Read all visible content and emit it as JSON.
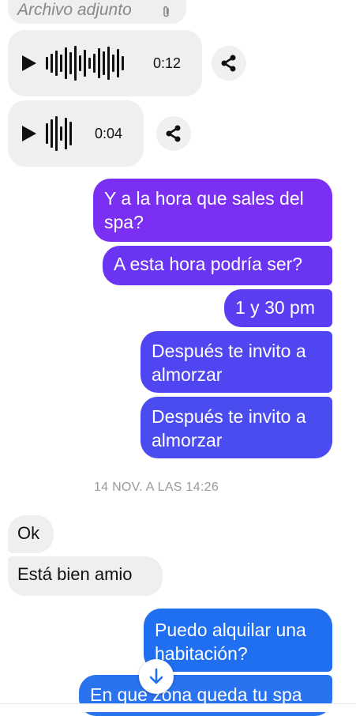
{
  "attachment": {
    "label": "Archivo adjunto",
    "icon": "paperclip-icon"
  },
  "audio_messages": [
    {
      "duration": "0:12"
    },
    {
      "duration": "0:04"
    }
  ],
  "outgoing_messages_1": [
    {
      "text": "Y a la hora que sales del spa?"
    },
    {
      "text": "A esta hora podría ser?"
    },
    {
      "text": "1 y 30 pm"
    },
    {
      "text": "Después te invito a almorzar"
    },
    {
      "text": "Después te invito a almorzar"
    }
  ],
  "timestamp": "14 NOV. A LAS 14:26",
  "incoming_messages": [
    {
      "text": "Ok"
    },
    {
      "text": "Está bien amio"
    }
  ],
  "outgoing_messages_2": [
    {
      "text": "Puedo alquilar una habitación?"
    },
    {
      "text": "En que zona queda tu spa"
    }
  ],
  "colors": {
    "purple": "#7a2ff2",
    "violet": "#5b3ef2",
    "indigo": "#4b4bf0",
    "blue": "#1f6ff0",
    "incoming_bg": "#efefef"
  }
}
